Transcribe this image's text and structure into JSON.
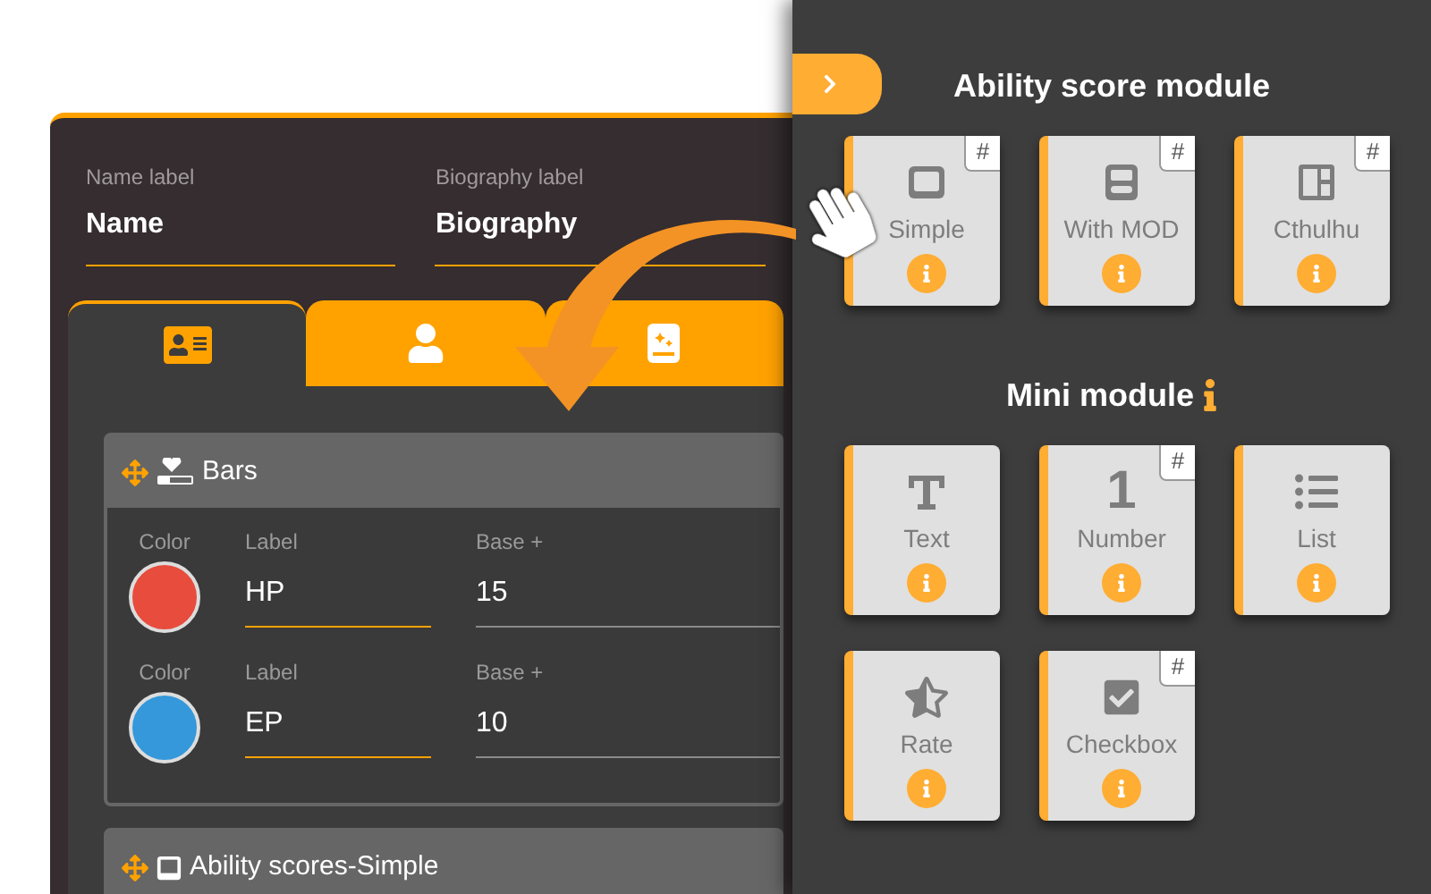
{
  "header": {
    "fields": [
      {
        "label": "Name label",
        "value": "Name"
      },
      {
        "label": "Biography label",
        "value": "Biography"
      }
    ]
  },
  "tabs": [
    {
      "kind": "id-card",
      "selected": true
    },
    {
      "kind": "user",
      "selected": false
    },
    {
      "kind": "book",
      "selected": false
    }
  ],
  "sections": [
    {
      "kind": "bars",
      "title": "Bars",
      "rows": [
        {
          "color_label": "Color",
          "color": "#e74c3c",
          "label_caption": "Label",
          "label_value": "HP",
          "base_caption": "Base +",
          "base_value": "15"
        },
        {
          "color_label": "Color",
          "color": "#3498db",
          "label_caption": "Label",
          "label_value": "EP",
          "base_caption": "Base +",
          "base_value": "10"
        }
      ]
    },
    {
      "kind": "ability",
      "title": "Ability scores-Simple"
    }
  ],
  "panel": {
    "groups": [
      {
        "title": "Ability score module",
        "info": false,
        "cards": [
          {
            "kind": "simple",
            "label": "Simple",
            "badge": "#"
          },
          {
            "kind": "with-mod",
            "label": "With MOD",
            "badge": "#"
          },
          {
            "kind": "cthulhu",
            "label": "Cthulhu",
            "badge": "#"
          }
        ]
      },
      {
        "title": "Mini module",
        "info": true,
        "cards": [
          {
            "kind": "text",
            "label": "Text"
          },
          {
            "kind": "number",
            "label": "Number",
            "badge": "#",
            "glyph": "1"
          },
          {
            "kind": "list",
            "label": "List"
          },
          {
            "kind": "rate",
            "label": "Rate"
          },
          {
            "kind": "checkbox",
            "label": "Checkbox",
            "badge": "#"
          }
        ]
      }
    ]
  }
}
